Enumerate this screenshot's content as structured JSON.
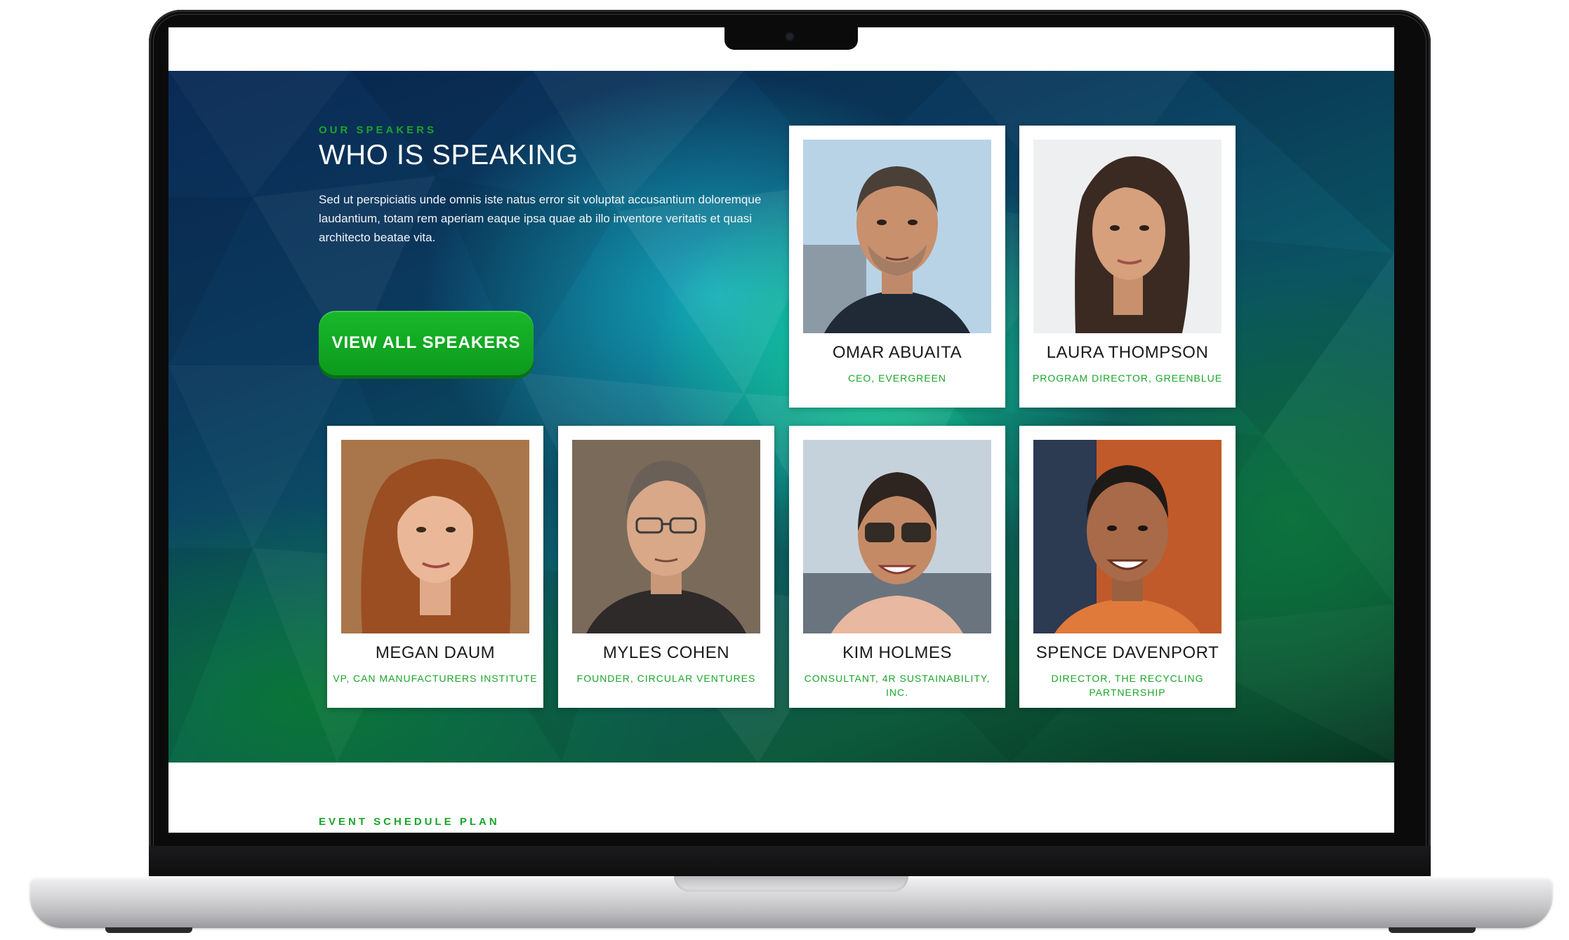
{
  "section": {
    "eyebrow": "OUR SPEAKERS",
    "title": "WHO IS SPEAKING",
    "description": "Sed ut perspiciatis unde omnis iste natus error sit voluptat accusantium doloremque laudantium, totam rem aperiam eaque ipsa quae ab illo inventore veritatis et quasi architecto beatae vita.",
    "cta_label": "VIEW ALL SPEAKERS"
  },
  "speakers": [
    {
      "name": "OMAR ABUAITA",
      "role": "CEO, EVERGREEN"
    },
    {
      "name": "LAURA THOMPSON",
      "role": "PROGRAM DIRECTOR, GREENBLUE"
    },
    {
      "name": "MEGAN DAUM",
      "role": "VP, CAN MANUFACTURERS INSTITUTE"
    },
    {
      "name": "MYLES COHEN",
      "role": "FOUNDER, CIRCULAR VENTURES"
    },
    {
      "name": "KIM HOLMES",
      "role": "CONSULTANT, 4R SUSTAINABILITY, INC."
    },
    {
      "name": "SPENCE DAVENPORT",
      "role": "DIRECTOR, THE RECYCLING PARTNERSHIP"
    }
  ],
  "next_section": {
    "eyebrow": "EVENT SCHEDULE PLAN"
  },
  "colors": {
    "accent_green": "#1aa52a",
    "button_green": "#12a823",
    "hero_dark_blue": "#0a2a55",
    "hero_teal": "#14bed2",
    "hero_green": "#0d5a3c"
  }
}
